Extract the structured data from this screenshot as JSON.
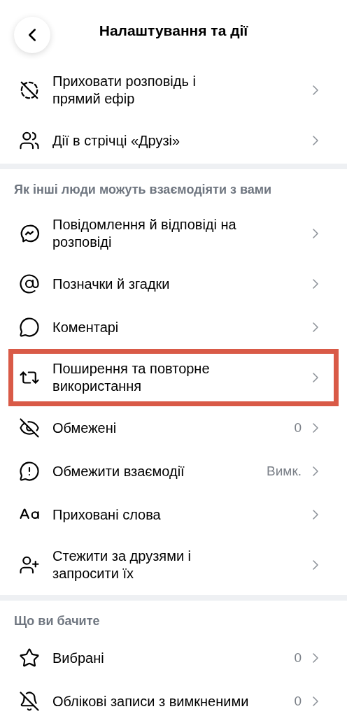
{
  "header": {
    "title": "Налаштування та дії"
  },
  "sections": [
    {
      "items": [
        {
          "label": "Приховати розповідь і прямий ефір",
          "highlighted": false
        },
        {
          "label": "Дії в стрічці «Друзі»",
          "highlighted": false
        }
      ]
    },
    {
      "title": "Як інші люди можуть взаємодіяти з вами",
      "items": [
        {
          "label": "Повідомлення й відповіді на розповіді",
          "highlighted": false
        },
        {
          "label": "Позначки й згадки",
          "highlighted": false
        },
        {
          "label": "Коментарі",
          "highlighted": false
        },
        {
          "label": "Поширення та повторне використання",
          "highlighted": true
        },
        {
          "label": "Обмежені",
          "value": "0",
          "highlighted": false
        },
        {
          "label": "Обмежити взаємодії",
          "value": "Вимк.",
          "highlighted": false
        },
        {
          "label": "Приховані слова",
          "highlighted": false
        },
        {
          "label": "Стежити за друзями і запросити їх",
          "highlighted": false
        }
      ]
    },
    {
      "title": "Що ви бачите",
      "items": [
        {
          "label": "Вибрані",
          "value": "0",
          "highlighted": false
        },
        {
          "label": "Облікові записи з вимкненими",
          "value": "0",
          "highlighted": false
        }
      ]
    }
  ]
}
